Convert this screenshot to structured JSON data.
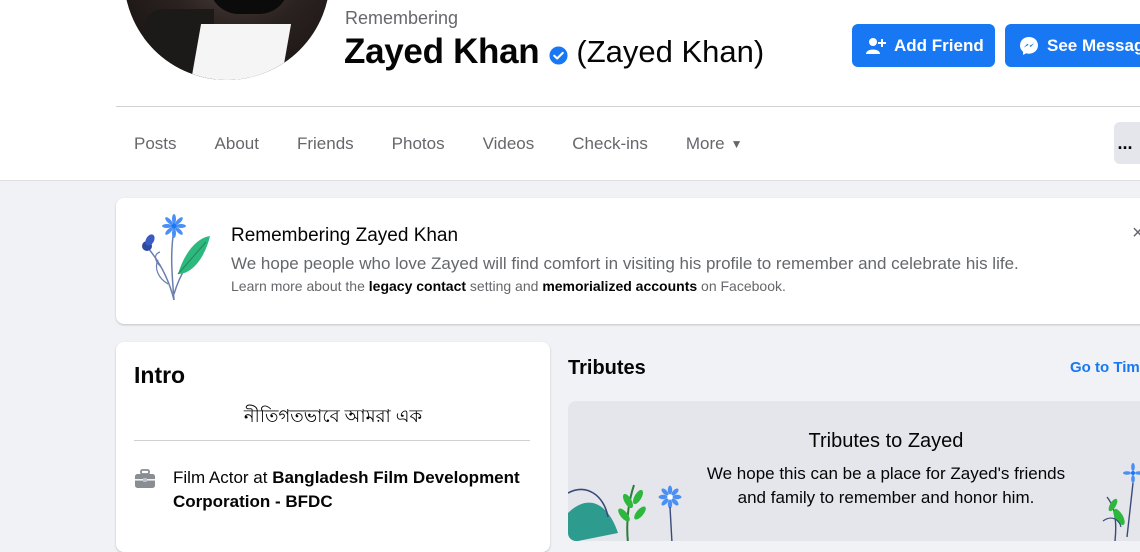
{
  "profile": {
    "remembering_label": "Remembering",
    "name": "Zayed Khan",
    "alternate_name": "(Zayed Khan)"
  },
  "actions": {
    "add_friend": "Add Friend",
    "see_message": "See Message"
  },
  "tabs": [
    {
      "label": "Posts"
    },
    {
      "label": "About"
    },
    {
      "label": "Friends"
    },
    {
      "label": "Photos"
    },
    {
      "label": "Videos"
    },
    {
      "label": "Check-ins"
    },
    {
      "label": "More"
    }
  ],
  "more_menu": {
    "dots": "..."
  },
  "memorial": {
    "title": "Remembering Zayed Khan",
    "text": "We hope people who love Zayed will find comfort in visiting his profile to remember and celebrate his life.",
    "note_prefix": "Learn more about the ",
    "legacy_link": "legacy contact",
    "note_middle": " setting and ",
    "memorialized_link": "memorialized accounts",
    "note_suffix": " on Facebook.",
    "close": "×"
  },
  "intro": {
    "title": "Intro",
    "bio": "নীতিগতভাবে আমরা এক",
    "work_prefix": "Film Actor at ",
    "work_place": "Bangladesh Film Development Corporation - BFDC"
  },
  "tributes": {
    "heading": "Tributes",
    "link": "Go to Timeline",
    "box_title": "Tributes to Zayed",
    "box_text": "We hope this can be a place for Zayed's friends and family to remember and honor him."
  },
  "colors": {
    "brand_blue": "#1877f2",
    "verified_blue": "#1877f2",
    "page_bg": "#f0f2f5"
  },
  "icons": {
    "verified": "verified-badge-icon",
    "add_friend": "add-person-icon",
    "message": "messenger-icon",
    "briefcase": "briefcase-icon",
    "flower": "memorial-flower-icon"
  }
}
